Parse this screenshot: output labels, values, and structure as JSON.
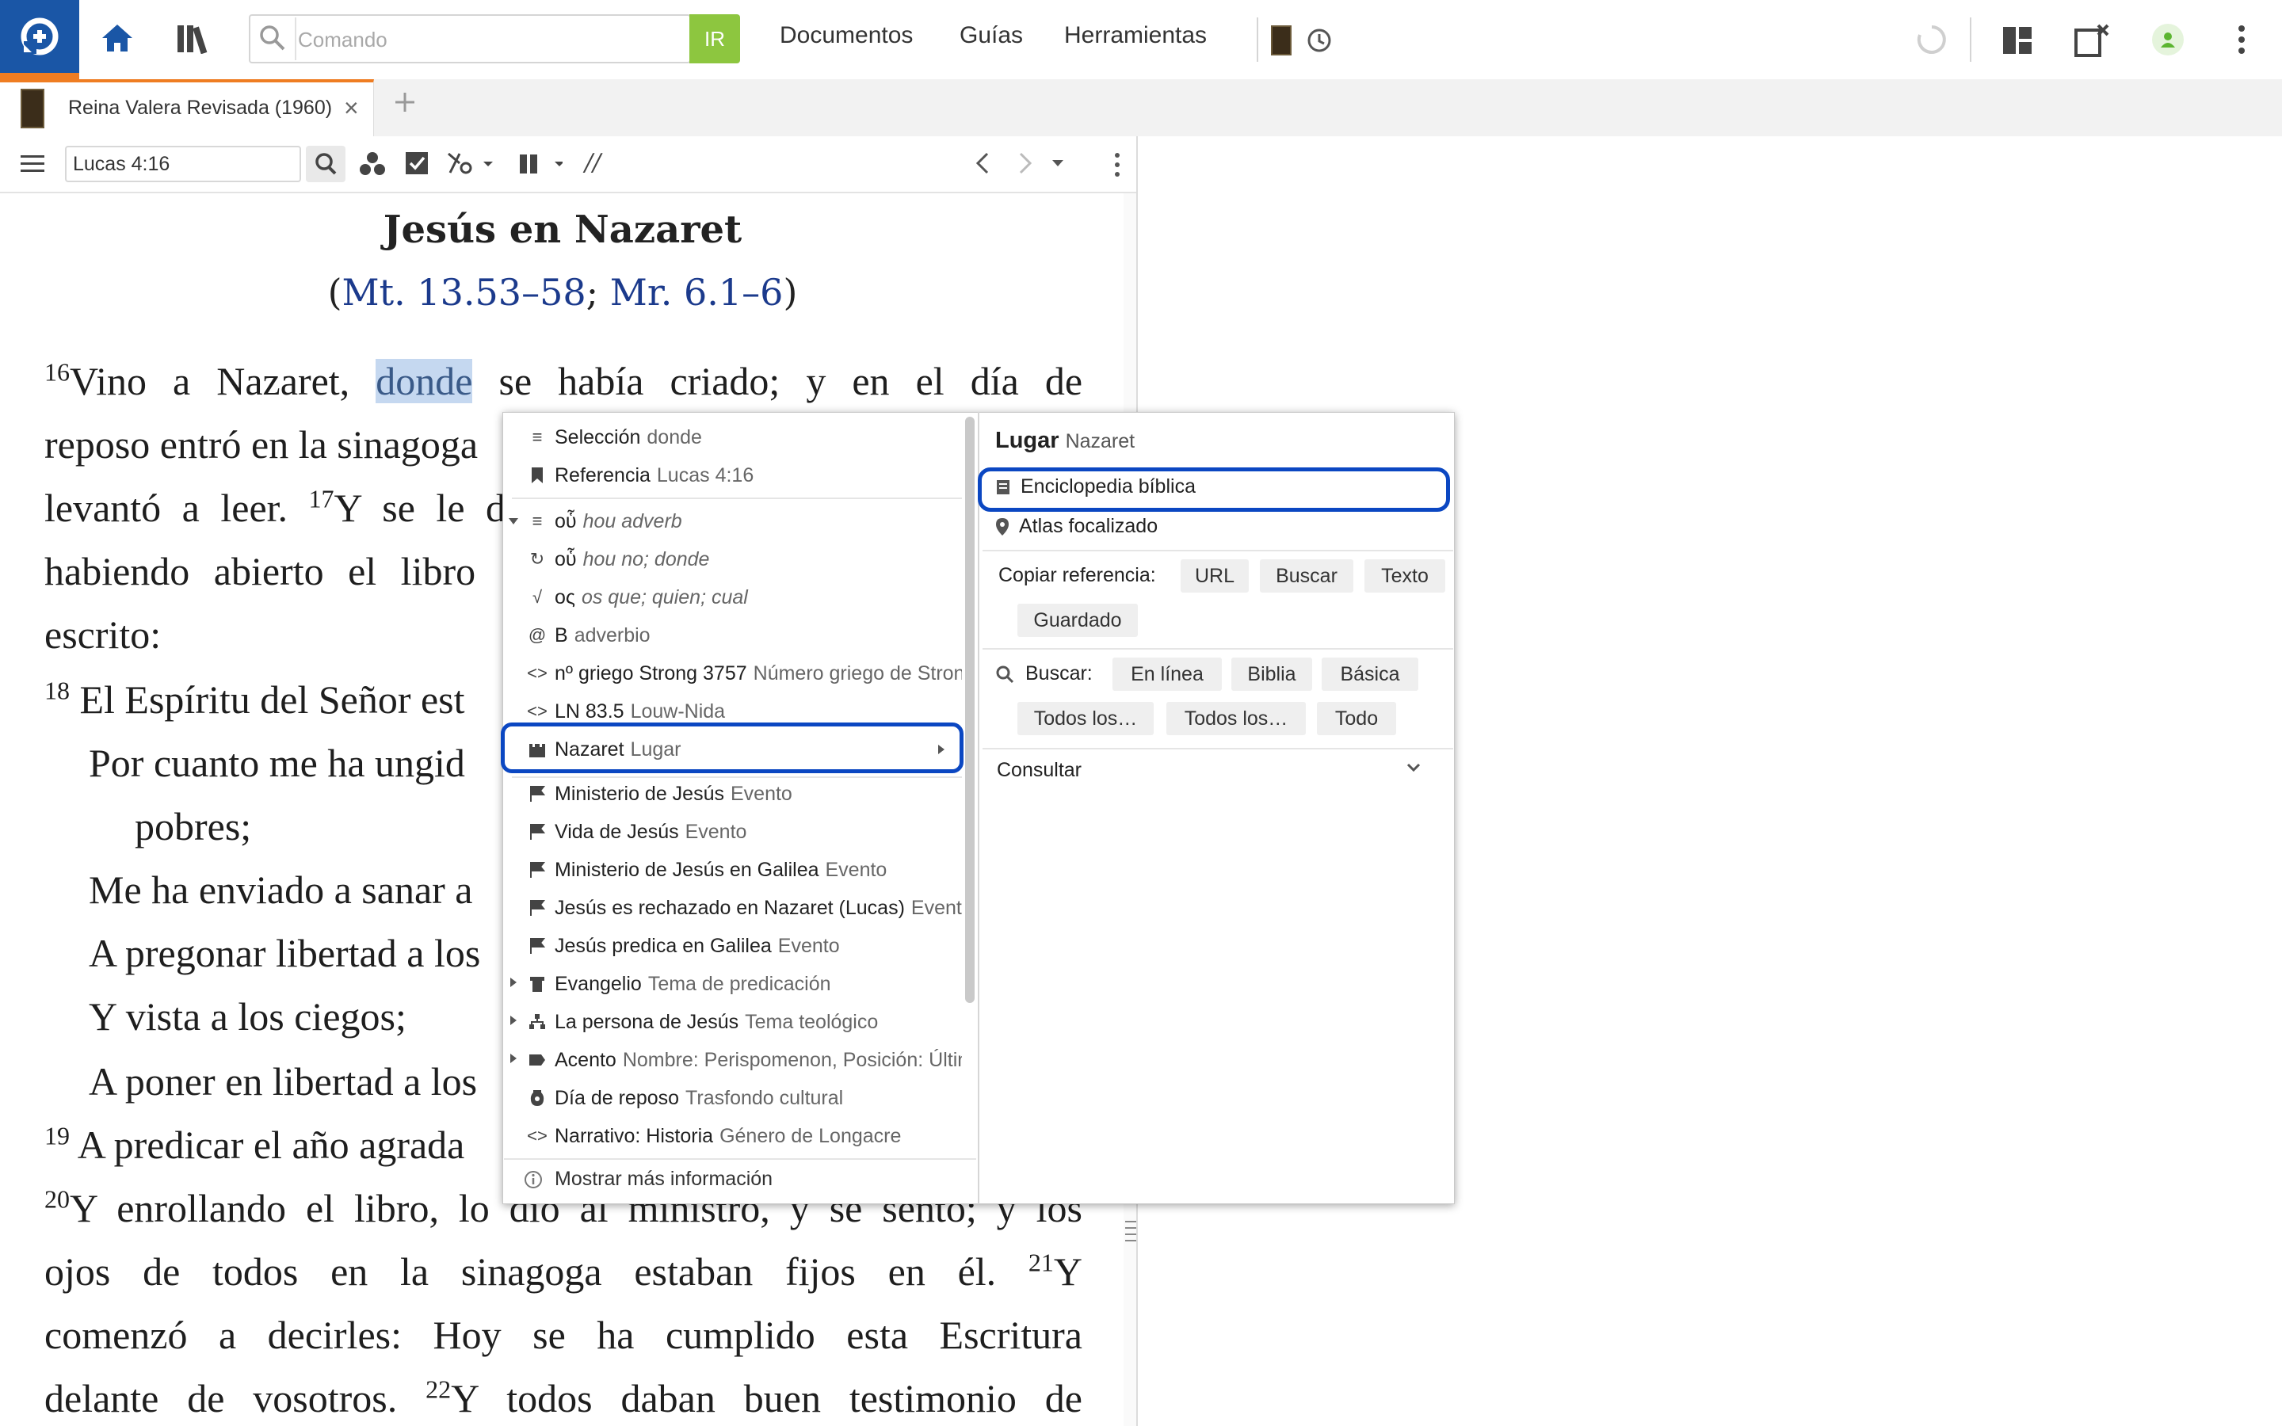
{
  "top_bar": {
    "command_placeholder": "Comando",
    "go_label": "IR",
    "nav_links": [
      "Documentos",
      "Guías",
      "Herramientas"
    ],
    "colors": {
      "brand": "#1a56a6",
      "accent": "#ef7d22",
      "go": "#8dc63f",
      "link": "#1b3a8c",
      "highlight": "#0b47c2"
    }
  },
  "tabs": [
    {
      "label": "Reina Valera Revisada (1960)",
      "close": "×"
    }
  ],
  "panel": {
    "reference_value": "Lucas 4:16",
    "separator_label": "//"
  },
  "bible": {
    "title": "Jesús en Nazaret",
    "refs": {
      "open": "(",
      "a": "Mt. 13.53–58",
      "sep": "; ",
      "b": "Mr. 6.1–6",
      "close": ")"
    },
    "v16": "16",
    "line1_pre": "Vino a Nazaret,",
    "line1_hl": "donde",
    "line1_post": "se había criado; y en el día de",
    "line2": "reposo entró en la sinagoga",
    "line3_pre": "levantó a leer.",
    "v17": "17",
    "line3_post": "Y se le d",
    "line4": "habiendo abierto el libro",
    "line5": "escrito:",
    "v18": "18",
    "line6": "El Espíritu del Señor est",
    "line7": "Por cuanto me ha ungid",
    "line8": "pobres;",
    "line9": "Me ha enviado a sanar a",
    "line10": "A pregonar libertad a los",
    "line11": "Y vista a los ciegos;",
    "line12": "A poner en libertad a los",
    "v19": "19",
    "line13": "A predicar el año agrada",
    "v20": "20",
    "line14": "Y enrollando el libro, lo dio al ministro, y se sentó; y los",
    "line15_pre": "ojos de todos en la sinagoga estaban fijos en él.",
    "v21": "21",
    "line15_post": "Y",
    "line16": "comenzó a decirles: Hoy se ha cumplido esta Escritura",
    "line17_pre": "delante de vosotros.",
    "v22": "22",
    "line17_post": "Y todos daban buen testimonio de"
  },
  "context_menu": {
    "items": [
      {
        "label": "Selección",
        "sub": "donde"
      },
      {
        "label": "Referencia",
        "sub": "Lucas 4:16"
      },
      {
        "label": "oὗ",
        "sub": "hou adverb"
      },
      {
        "label": "oὗ",
        "sub": "hou no; donde"
      },
      {
        "label": "ος",
        "sub": "os que; quien; cual"
      },
      {
        "label": "B",
        "sub": "adverbio"
      },
      {
        "label": "nº griego Strong 3757",
        "sub": "Número griego de Strong"
      },
      {
        "label": "LN 83.5",
        "sub": "Louw-Nida"
      },
      {
        "label": "Nazaret",
        "sub": "Lugar"
      },
      {
        "label": "Ministerio de Jesús",
        "sub": "Evento"
      },
      {
        "label": "Vida de Jesús",
        "sub": "Evento"
      },
      {
        "label": "Ministerio de Jesús en Galilea",
        "sub": "Evento"
      },
      {
        "label": "Jesús es rechazado en Nazaret (Lucas)",
        "sub": "Evento"
      },
      {
        "label": "Jesús predica en Galilea",
        "sub": "Evento"
      },
      {
        "label": "Evangelio",
        "sub": "Tema de predicación"
      },
      {
        "label": "La persona de Jesús",
        "sub": "Tema teológico"
      },
      {
        "label": "Acento",
        "sub": "Nombre: Perispomenon, Posición: Última"
      },
      {
        "label": "Día de reposo",
        "sub": "Trasfondo cultural"
      },
      {
        "label": "Narrativo: Historia",
        "sub": "Género de Longacre"
      }
    ],
    "more_info": "Mostrar más información"
  },
  "submenu": {
    "title": "Lugar",
    "title_sub": "Nazaret",
    "encyclopedia": "Enciclopedia bíblica",
    "atlas": "Atlas focalizado",
    "copy_label": "Copiar referencia:",
    "copy_buttons": [
      "URL",
      "Buscar",
      "Texto",
      "Guardado"
    ],
    "search_label": "Buscar:",
    "search_buttons": [
      "En línea",
      "Biblia",
      "Básica",
      "Todos los…",
      "Todos los…",
      "Todo"
    ],
    "consult_label": "Consultar"
  }
}
